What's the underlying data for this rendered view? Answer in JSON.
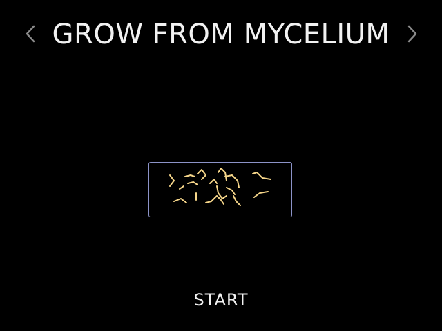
{
  "header": {
    "title": "GROW FROM MYCELIUM",
    "prev_icon": "chevron-left-icon",
    "next_icon": "chevron-right-icon"
  },
  "preview": {
    "frame_color": "#8c93c8",
    "hypha_color": "#f6d68a"
  },
  "menu": {
    "start_label": "START"
  },
  "colors": {
    "background": "#000000",
    "text": "#f2f2f2",
    "arrow": "#8a8a8a"
  }
}
